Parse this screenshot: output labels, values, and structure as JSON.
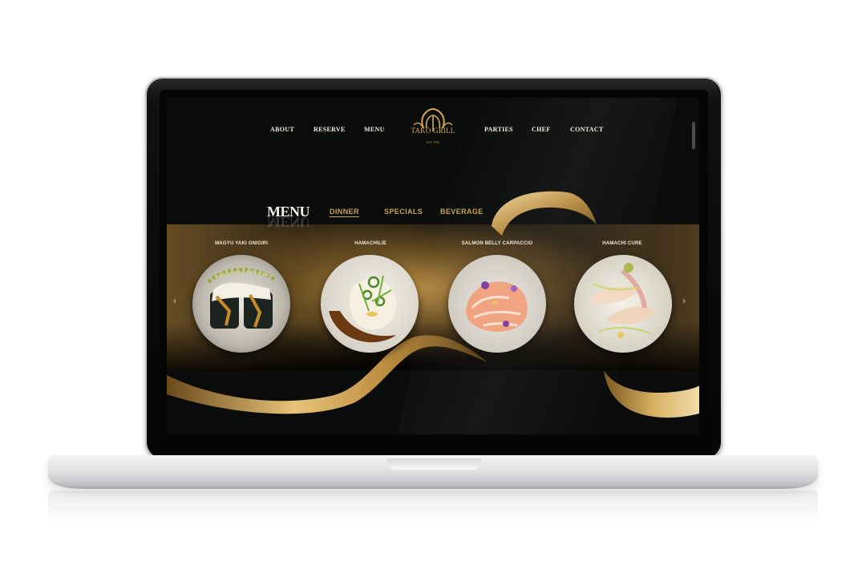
{
  "nav": {
    "left_links": [
      "ABOUT",
      "RESERVE",
      "MENU"
    ],
    "right_links": [
      "PARTIES",
      "CHEF",
      "CONTACT"
    ],
    "logo_text": "TAKO GRILL",
    "logo_sub": "EST 1994"
  },
  "menu": {
    "title": "MENU",
    "tabs": [
      "DINNER",
      "SPECIALS",
      "BEVERAGE"
    ],
    "active_tab": "DINNER"
  },
  "dishes": [
    {
      "name": "WAGYU YAKI ONIGIRI"
    },
    {
      "name": "HAMACHILIE"
    },
    {
      "name": "SALMON BELLY CARPACCIO"
    },
    {
      "name": "HAMACHI CURE"
    }
  ],
  "carousel": {
    "prev_icon": "‹",
    "next_icon": "›"
  },
  "colors": {
    "gold": "#c9a24d",
    "background": "#0a0c0b",
    "text": "#f1ede4"
  }
}
